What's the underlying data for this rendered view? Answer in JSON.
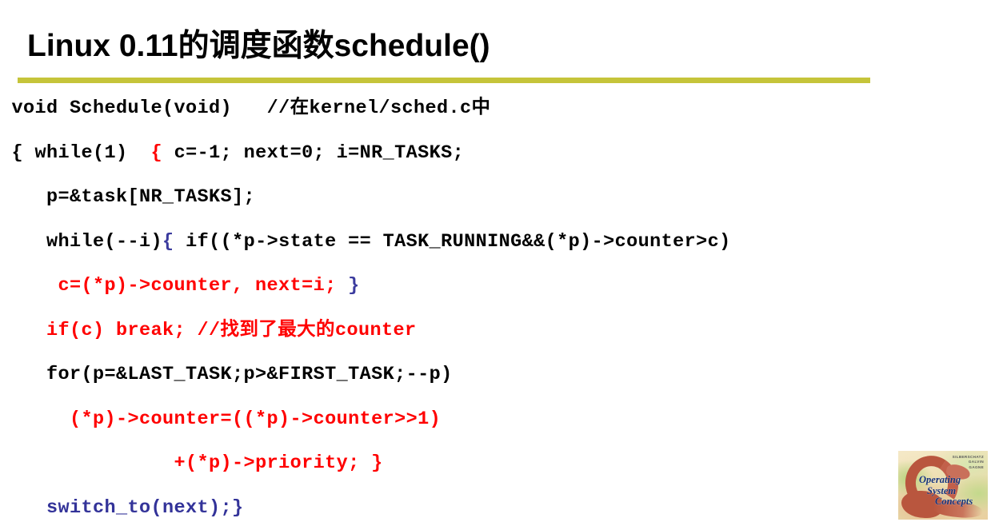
{
  "slide": {
    "title": "Linux 0.11的调度函数schedule()",
    "rule_color": "#c5c43a",
    "background_color": "#ffffff"
  },
  "colors": {
    "code_default": "#000000",
    "code_highlight_red": "#ff0000",
    "code_highlight_blue": "#333399",
    "brace_purple": "#3b3b9e",
    "rule": "#c5c43a"
  },
  "code": {
    "language": "c",
    "lines": [
      {
        "id": "line-1",
        "indent": 0,
        "tokens": [
          {
            "text": "void Schedule(void)   //在kernel/sched.c中",
            "color": "black"
          }
        ]
      },
      {
        "id": "line-2",
        "indent": 0,
        "tokens": [
          {
            "text": "{ while(1)  ",
            "color": "black"
          },
          {
            "text": "{",
            "color": "red"
          },
          {
            "text": " c=-1; next=0; i=NR_TASKS;",
            "color": "black"
          }
        ]
      },
      {
        "id": "line-3",
        "indent": 3,
        "tokens": [
          {
            "text": "p=&task[NR_TASKS];",
            "color": "black"
          }
        ]
      },
      {
        "id": "line-4",
        "indent": 3,
        "tokens": [
          {
            "text": "while(--i)",
            "color": "black"
          },
          {
            "text": "{",
            "color": "purple"
          },
          {
            "text": " if((*p->state == TASK_RUNNING&&(*p)->counter>c)",
            "color": "black"
          }
        ]
      },
      {
        "id": "line-5",
        "indent": 4,
        "tokens": [
          {
            "text": "c=(*p)->counter, next=i; ",
            "color": "red"
          },
          {
            "text": "}",
            "color": "purple"
          }
        ]
      },
      {
        "id": "line-6",
        "indent": 3,
        "tokens": [
          {
            "text": "if(c) break; //找到了最大的counter",
            "color": "red"
          }
        ]
      },
      {
        "id": "line-7",
        "indent": 3,
        "tokens": [
          {
            "text": "for(p=&LAST_TASK;p>&FIRST_TASK;--p)",
            "color": "black"
          }
        ]
      },
      {
        "id": "line-8",
        "indent": 5,
        "tokens": [
          {
            "text": "(*p)->counter=((*p)->counter>>1)",
            "color": "red"
          }
        ]
      },
      {
        "id": "line-9",
        "indent": 14,
        "tokens": [
          {
            "text": "+(*p)->priority; }",
            "color": "red"
          }
        ]
      },
      {
        "id": "line-10",
        "indent": 2,
        "tokens": [
          {
            "text": " switch_to(next);}",
            "color": "blue"
          }
        ]
      }
    ]
  },
  "book_logo": {
    "title_line_1": "Operating",
    "title_line_2": "System",
    "title_line_3": "Concepts",
    "author_1": "SILBERSCHATZ",
    "author_2": "GALVIN",
    "author_3": "GAGNE"
  }
}
